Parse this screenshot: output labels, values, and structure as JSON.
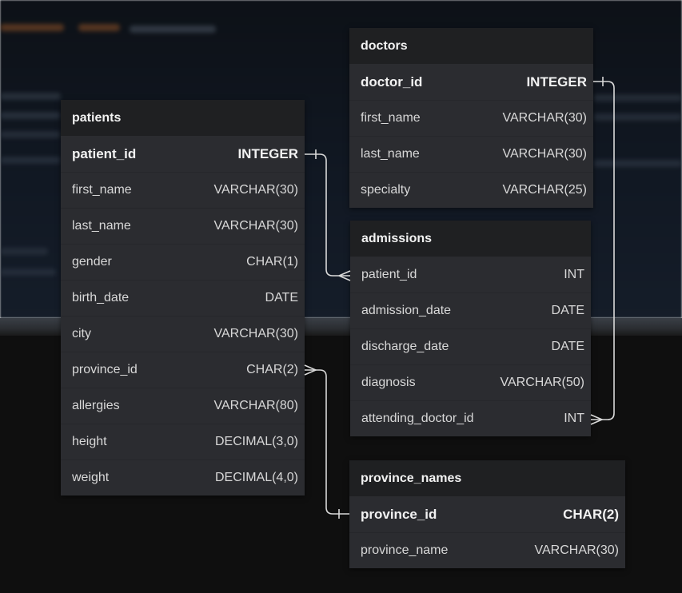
{
  "tables": {
    "patients": {
      "name": "patients",
      "columns": [
        {
          "name": "patient_id",
          "type": "INTEGER",
          "pk": true
        },
        {
          "name": "first_name",
          "type": "VARCHAR(30)"
        },
        {
          "name": "last_name",
          "type": "VARCHAR(30)"
        },
        {
          "name": "gender",
          "type": "CHAR(1)"
        },
        {
          "name": "birth_date",
          "type": "DATE"
        },
        {
          "name": "city",
          "type": "VARCHAR(30)"
        },
        {
          "name": "province_id",
          "type": "CHAR(2)"
        },
        {
          "name": "allergies",
          "type": "VARCHAR(80)"
        },
        {
          "name": "height",
          "type": "DECIMAL(3,0)"
        },
        {
          "name": "weight",
          "type": "DECIMAL(4,0)"
        }
      ]
    },
    "doctors": {
      "name": "doctors",
      "columns": [
        {
          "name": "doctor_id",
          "type": "INTEGER",
          "pk": true
        },
        {
          "name": "first_name",
          "type": "VARCHAR(30)"
        },
        {
          "name": "last_name",
          "type": "VARCHAR(30)"
        },
        {
          "name": "specialty",
          "type": "VARCHAR(25)"
        }
      ]
    },
    "admissions": {
      "name": "admissions",
      "columns": [
        {
          "name": "patient_id",
          "type": "INT"
        },
        {
          "name": "admission_date",
          "type": "DATE"
        },
        {
          "name": "discharge_date",
          "type": "DATE"
        },
        {
          "name": "diagnosis",
          "type": "VARCHAR(50)"
        },
        {
          "name": "attending_doctor_id",
          "type": "INT"
        }
      ]
    },
    "province_names": {
      "name": "province_names",
      "columns": [
        {
          "name": "province_id",
          "type": "CHAR(2)",
          "pk": true
        },
        {
          "name": "province_name",
          "type": "VARCHAR(30)"
        }
      ]
    }
  },
  "relationships": [
    {
      "from": "patients.patient_id",
      "to": "admissions.patient_id",
      "cardinality": "one-to-many"
    },
    {
      "from": "doctors.doctor_id",
      "to": "admissions.attending_doctor_id",
      "cardinality": "one-to-many"
    },
    {
      "from": "province_names.province_id",
      "to": "patients.province_id",
      "cardinality": "one-to-many"
    }
  ],
  "colors": {
    "table_body": "#2b2c30",
    "table_header": "#1f2022",
    "connector": "#d9d9d9",
    "background": "#0f0f0f"
  }
}
